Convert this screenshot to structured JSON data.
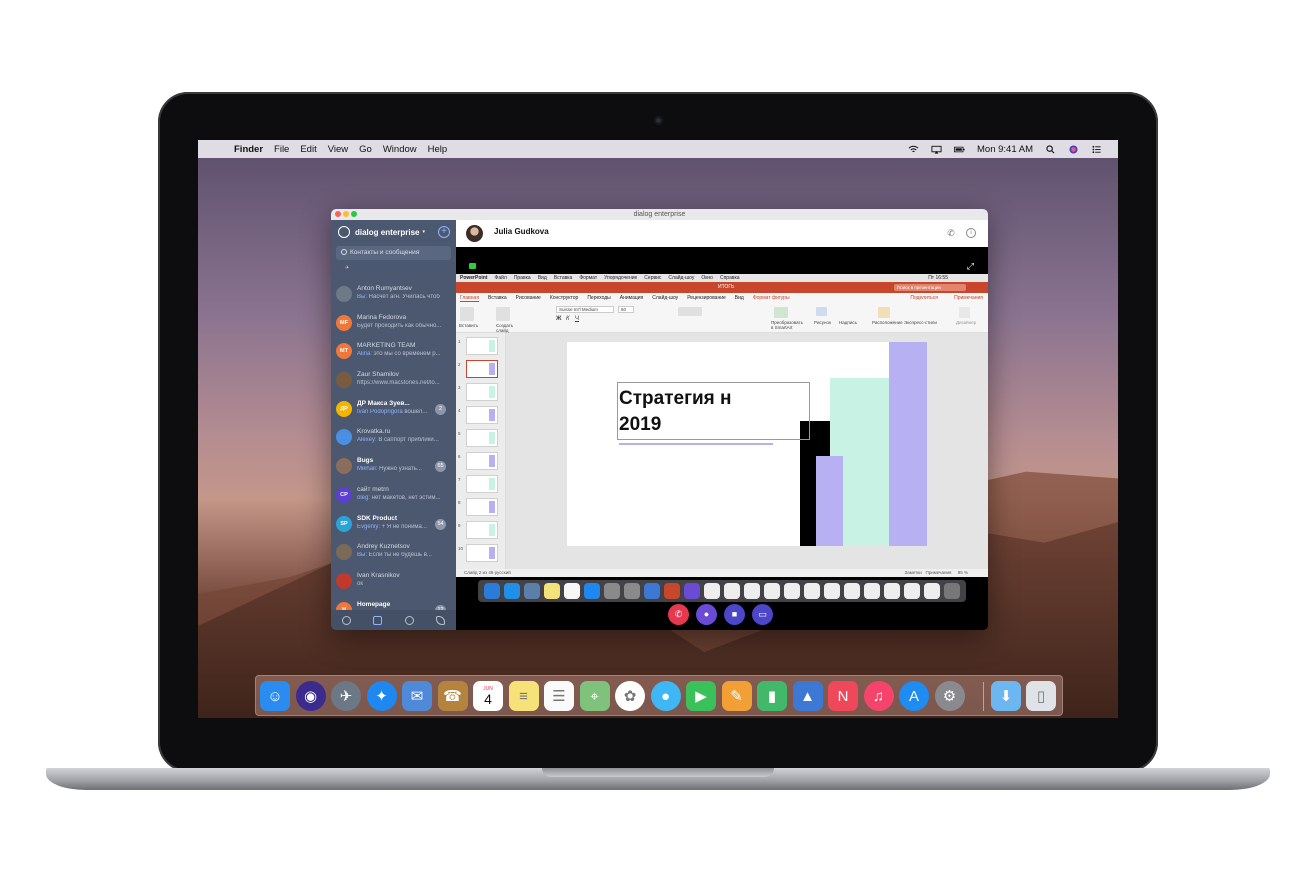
{
  "menubar": {
    "app": "Finder",
    "items": [
      "File",
      "Edit",
      "View",
      "Go",
      "Window",
      "Help"
    ],
    "clock": "Mon 9:41 AM"
  },
  "window": {
    "title": "dialog enterprise",
    "sidebar": {
      "workspace": "dialog enterprise",
      "search_placeholder": "Контакты и сообщения",
      "chats": [
        {
          "initials": "",
          "name": "Anton Rumyantsev",
          "prefix": "Вы:",
          "msg": " Насчёт агн. Училась чтоб",
          "badge": "",
          "color": "#6e7a87",
          "bold": false
        },
        {
          "initials": "MF",
          "name": "Marina Fedorova",
          "prefix": "",
          "msg": "Будет проходить как обычно...",
          "badge": "",
          "color": "#f0773a",
          "bold": false
        },
        {
          "initials": "MT",
          "name": "MARKETING TEAM",
          "prefix": "Alina:",
          "msg": " это мы со временем р...",
          "badge": "",
          "color": "#f0773a",
          "bold": false
        },
        {
          "initials": "",
          "name": "Zaur Shamilov",
          "prefix": "",
          "msg": "https://www.macstories.net/lo...",
          "badge": "",
          "color": "#7a5b3e",
          "bold": false
        },
        {
          "initials": "ДР",
          "name": "ДР Макса Зуев...",
          "prefix": "Ivan Podoprigora",
          "msg": " вошел...",
          "badge": "2",
          "color": "#f4b400",
          "bold": true
        },
        {
          "initials": "",
          "name": "Krovatka.ru",
          "prefix": "Alexey:",
          "msg": " В саппорт приблики...",
          "badge": "",
          "color": "#4a90e2",
          "bold": false
        },
        {
          "initials": "",
          "name": "Bugs",
          "prefix": "Mikhail:",
          "msg": " Нужно узнать...",
          "badge": "65",
          "color": "#8a6d5a",
          "bold": true
        },
        {
          "initials": "CP",
          "name": "сайт metrn",
          "prefix": "oleg:",
          "msg": " нет макетов, нет эстим...",
          "badge": "",
          "color": "#5b3fd1",
          "bold": false
        },
        {
          "initials": "SP",
          "name": "SDK Product",
          "prefix": "Evgeniy:",
          "msg": " + Я не понима...",
          "badge": "54",
          "color": "#2aa3d6",
          "bold": true
        },
        {
          "initials": "",
          "name": "Andrey Kuznetsov",
          "prefix": "Вы:",
          "msg": " Если ты не будешь в...",
          "badge": "",
          "color": "#7c6a58",
          "bold": false
        },
        {
          "initials": "",
          "name": "Ivan Krasnikov",
          "prefix": "",
          "msg": "ок",
          "badge": "",
          "color": "#c0392b",
          "bold": false
        },
        {
          "initials": "H",
          "name": "Homepage",
          "prefix": "",
          "msg": "",
          "badge": "12",
          "color": "#f0773a",
          "bold": true
        }
      ]
    },
    "call": {
      "contact": "Julia Gudkova",
      "shared": {
        "menubar": [
          "PowerPoint",
          "Файл",
          "Правка",
          "Вид",
          "Вставка",
          "Формат",
          "Упорядочение",
          "Сервис",
          "Слайд-шоу",
          "Окно",
          "Справка"
        ],
        "menubar_clock": "Пт 16:55",
        "doc_title": "ИТОГЬ",
        "search": "Поиск в презентации",
        "tabs": [
          "Главная",
          "Вставка",
          "Рисование",
          "Конструктор",
          "Переходы",
          "Анимация",
          "Слайд-шоу",
          "Рецензирование",
          "Вид"
        ],
        "tab_format": "Формат фигуры",
        "share": "Поделиться",
        "notes": "Примечания",
        "font": "Suisse Int'l Medium",
        "font_size": "60",
        "ribbon": {
          "paste": "Вставить",
          "create": "Создать слайд",
          "convert": "Преобразовать в SmartArt",
          "picture": "Рисунок",
          "text": "Надпись",
          "arrange": "Расположение",
          "styles": "Экспресс-стили",
          "designer": "Дизайнер"
        },
        "thumbs": [
          "1",
          "2",
          "3",
          "4",
          "5",
          "6",
          "7",
          "8",
          "9",
          "10"
        ],
        "slide_title": "Стратегия н\n2019",
        "status": "Слайд 2 из 49   русский",
        "status_notes": "Заметки",
        "status_comments": "Примечания",
        "zoom": "95 %"
      }
    }
  },
  "colors": {
    "accent_green": "#c8f2e4",
    "accent_lilac": "#b7b1f4",
    "ppt_red": "#c8462b",
    "end_call": "#e53950",
    "purple": "#6a4bd6"
  },
  "dock": [
    "finder-icon",
    "siri-icon",
    "launchpad-icon",
    "safari-icon",
    "mail-icon",
    "contacts-icon",
    "calendar-icon",
    "notes-icon",
    "reminders-icon",
    "maps-icon",
    "photos-icon",
    "messages-icon",
    "facetime-icon",
    "pages-icon",
    "numbers-icon",
    "keynote-icon",
    "news-icon",
    "music-icon",
    "app-store-icon",
    "system-preferences-icon",
    "downloads-icon",
    "trash-icon"
  ],
  "calendar": {
    "month": "JUN",
    "day": "4"
  }
}
